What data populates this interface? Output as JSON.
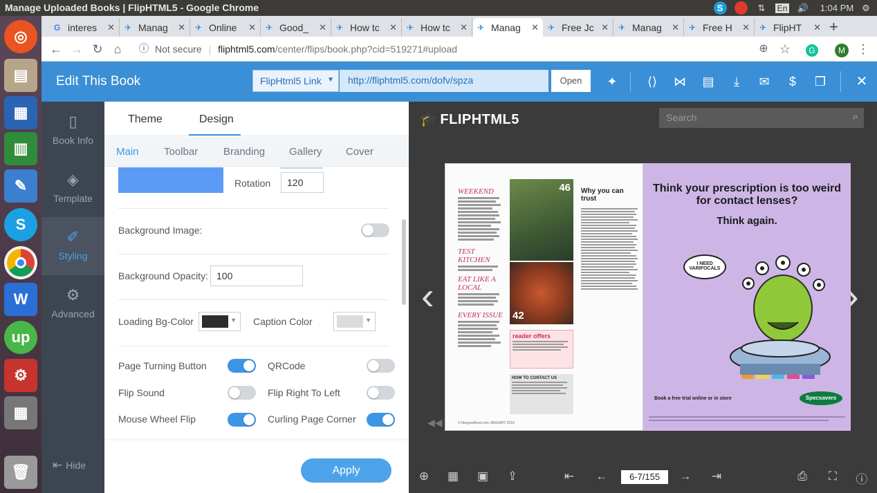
{
  "window": {
    "title": "Manage Uploaded Books | FlipHTML5 - Google Chrome"
  },
  "tray": {
    "lang": "En",
    "clock": "1:04 PM"
  },
  "tabs": [
    {
      "label": "interes"
    },
    {
      "label": "Manag"
    },
    {
      "label": "Online"
    },
    {
      "label": "Good_"
    },
    {
      "label": "How tc"
    },
    {
      "label": "How tc"
    },
    {
      "label": "Manag"
    },
    {
      "label": "Free Jc"
    },
    {
      "label": "Manag"
    },
    {
      "label": "Free H"
    },
    {
      "label": "FlipHT"
    }
  ],
  "addressbar": {
    "security": "Not secure",
    "domain": "fliphtml5.com",
    "path": "/center/flips/book.php?cid=519271#upload"
  },
  "profile": {
    "initial": "M"
  },
  "header": {
    "title": "Edit This Book",
    "link_type": "FlipHtml5 Link",
    "link_url": "http://fliphtml5.com/dofv/spza",
    "open_label": "Open"
  },
  "leftnav": {
    "items": [
      {
        "label": "Book Info"
      },
      {
        "label": "Template"
      },
      {
        "label": "Styling"
      },
      {
        "label": "Advanced"
      }
    ],
    "hide_label": "Hide"
  },
  "panel": {
    "tabs": [
      "Theme",
      "Design"
    ],
    "subtabs": [
      "Main",
      "Toolbar",
      "Branding",
      "Gallery",
      "Cover"
    ],
    "rotation_label": "Rotation",
    "rotation_value": "120",
    "bg_image_label": "Background Image:",
    "bg_opacity_label": "Background Opacity:",
    "bg_opacity_value": "100",
    "loading_bg_label": "Loading Bg-Color",
    "caption_color_label": "Caption Color",
    "colors": {
      "accent_swatch": "#5b9bf5",
      "loading_bg": "#2d2d2d",
      "caption": "#dcdcdc"
    },
    "toggles": [
      {
        "label": "Page Turning Button",
        "on": true
      },
      {
        "label": "QRCode",
        "on": false
      },
      {
        "label": "Flip Sound",
        "on": false
      },
      {
        "label": "Flip Right To Left",
        "on": false
      },
      {
        "label": "Mouse Wheel Flip",
        "on": true
      },
      {
        "label": "Curling Page Corner",
        "on": true
      }
    ],
    "apply_label": "Apply"
  },
  "preview": {
    "logo": "FLIPHTML5",
    "search_placeholder": "Search",
    "page_indicator": "6-7/155",
    "left_page": {
      "section1": "WEEKEND",
      "section2": "TEST KITCHEN",
      "section3": "EAT LIKE A LOCAL",
      "section4": "EVERY ISSUE",
      "page_num_a": "46",
      "page_num_b": "42",
      "trust_title": "Why you can trust",
      "reader_offers": "reader offers",
      "contact": "HOW TO CONTACT US",
      "footer": "© bbcgoodfood.com   JANUARY 2019"
    },
    "right_page": {
      "headline": "Think your prescription is too weird for contact lenses?",
      "subhead": "Think again.",
      "bubble": "I NEED VARIFOCALS",
      "cta": "Book a free trial online or in store",
      "brand": "Specsavers"
    }
  }
}
